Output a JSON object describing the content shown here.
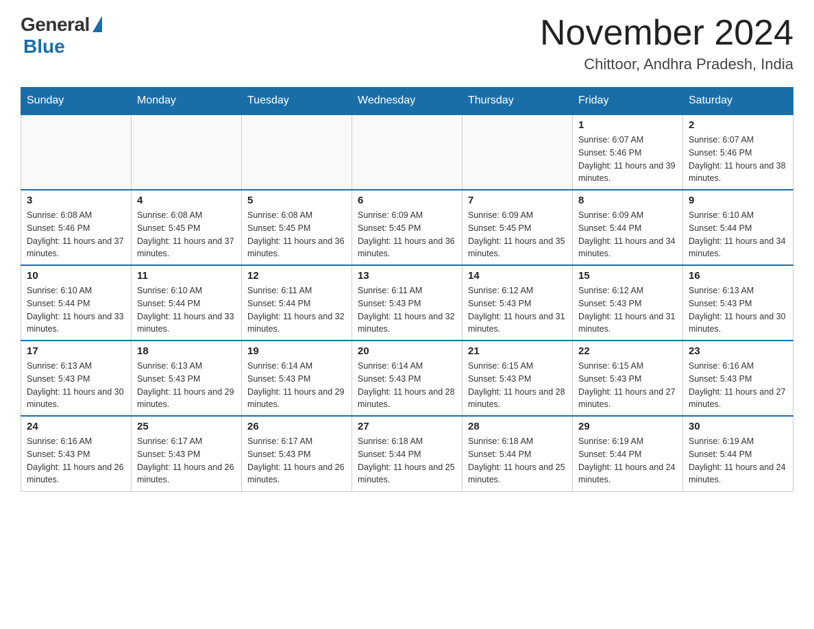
{
  "logo": {
    "general": "General",
    "blue": "Blue"
  },
  "title": "November 2024",
  "location": "Chittoor, Andhra Pradesh, India",
  "days_of_week": [
    "Sunday",
    "Monday",
    "Tuesday",
    "Wednesday",
    "Thursday",
    "Friday",
    "Saturday"
  ],
  "weeks": [
    [
      {
        "day": "",
        "info": ""
      },
      {
        "day": "",
        "info": ""
      },
      {
        "day": "",
        "info": ""
      },
      {
        "day": "",
        "info": ""
      },
      {
        "day": "",
        "info": ""
      },
      {
        "day": "1",
        "info": "Sunrise: 6:07 AM\nSunset: 5:46 PM\nDaylight: 11 hours and 39 minutes."
      },
      {
        "day": "2",
        "info": "Sunrise: 6:07 AM\nSunset: 5:46 PM\nDaylight: 11 hours and 38 minutes."
      }
    ],
    [
      {
        "day": "3",
        "info": "Sunrise: 6:08 AM\nSunset: 5:46 PM\nDaylight: 11 hours and 37 minutes."
      },
      {
        "day": "4",
        "info": "Sunrise: 6:08 AM\nSunset: 5:45 PM\nDaylight: 11 hours and 37 minutes."
      },
      {
        "day": "5",
        "info": "Sunrise: 6:08 AM\nSunset: 5:45 PM\nDaylight: 11 hours and 36 minutes."
      },
      {
        "day": "6",
        "info": "Sunrise: 6:09 AM\nSunset: 5:45 PM\nDaylight: 11 hours and 36 minutes."
      },
      {
        "day": "7",
        "info": "Sunrise: 6:09 AM\nSunset: 5:45 PM\nDaylight: 11 hours and 35 minutes."
      },
      {
        "day": "8",
        "info": "Sunrise: 6:09 AM\nSunset: 5:44 PM\nDaylight: 11 hours and 34 minutes."
      },
      {
        "day": "9",
        "info": "Sunrise: 6:10 AM\nSunset: 5:44 PM\nDaylight: 11 hours and 34 minutes."
      }
    ],
    [
      {
        "day": "10",
        "info": "Sunrise: 6:10 AM\nSunset: 5:44 PM\nDaylight: 11 hours and 33 minutes."
      },
      {
        "day": "11",
        "info": "Sunrise: 6:10 AM\nSunset: 5:44 PM\nDaylight: 11 hours and 33 minutes."
      },
      {
        "day": "12",
        "info": "Sunrise: 6:11 AM\nSunset: 5:44 PM\nDaylight: 11 hours and 32 minutes."
      },
      {
        "day": "13",
        "info": "Sunrise: 6:11 AM\nSunset: 5:43 PM\nDaylight: 11 hours and 32 minutes."
      },
      {
        "day": "14",
        "info": "Sunrise: 6:12 AM\nSunset: 5:43 PM\nDaylight: 11 hours and 31 minutes."
      },
      {
        "day": "15",
        "info": "Sunrise: 6:12 AM\nSunset: 5:43 PM\nDaylight: 11 hours and 31 minutes."
      },
      {
        "day": "16",
        "info": "Sunrise: 6:13 AM\nSunset: 5:43 PM\nDaylight: 11 hours and 30 minutes."
      }
    ],
    [
      {
        "day": "17",
        "info": "Sunrise: 6:13 AM\nSunset: 5:43 PM\nDaylight: 11 hours and 30 minutes."
      },
      {
        "day": "18",
        "info": "Sunrise: 6:13 AM\nSunset: 5:43 PM\nDaylight: 11 hours and 29 minutes."
      },
      {
        "day": "19",
        "info": "Sunrise: 6:14 AM\nSunset: 5:43 PM\nDaylight: 11 hours and 29 minutes."
      },
      {
        "day": "20",
        "info": "Sunrise: 6:14 AM\nSunset: 5:43 PM\nDaylight: 11 hours and 28 minutes."
      },
      {
        "day": "21",
        "info": "Sunrise: 6:15 AM\nSunset: 5:43 PM\nDaylight: 11 hours and 28 minutes."
      },
      {
        "day": "22",
        "info": "Sunrise: 6:15 AM\nSunset: 5:43 PM\nDaylight: 11 hours and 27 minutes."
      },
      {
        "day": "23",
        "info": "Sunrise: 6:16 AM\nSunset: 5:43 PM\nDaylight: 11 hours and 27 minutes."
      }
    ],
    [
      {
        "day": "24",
        "info": "Sunrise: 6:16 AM\nSunset: 5:43 PM\nDaylight: 11 hours and 26 minutes."
      },
      {
        "day": "25",
        "info": "Sunrise: 6:17 AM\nSunset: 5:43 PM\nDaylight: 11 hours and 26 minutes."
      },
      {
        "day": "26",
        "info": "Sunrise: 6:17 AM\nSunset: 5:43 PM\nDaylight: 11 hours and 26 minutes."
      },
      {
        "day": "27",
        "info": "Sunrise: 6:18 AM\nSunset: 5:44 PM\nDaylight: 11 hours and 25 minutes."
      },
      {
        "day": "28",
        "info": "Sunrise: 6:18 AM\nSunset: 5:44 PM\nDaylight: 11 hours and 25 minutes."
      },
      {
        "day": "29",
        "info": "Sunrise: 6:19 AM\nSunset: 5:44 PM\nDaylight: 11 hours and 24 minutes."
      },
      {
        "day": "30",
        "info": "Sunrise: 6:19 AM\nSunset: 5:44 PM\nDaylight: 11 hours and 24 minutes."
      }
    ]
  ]
}
